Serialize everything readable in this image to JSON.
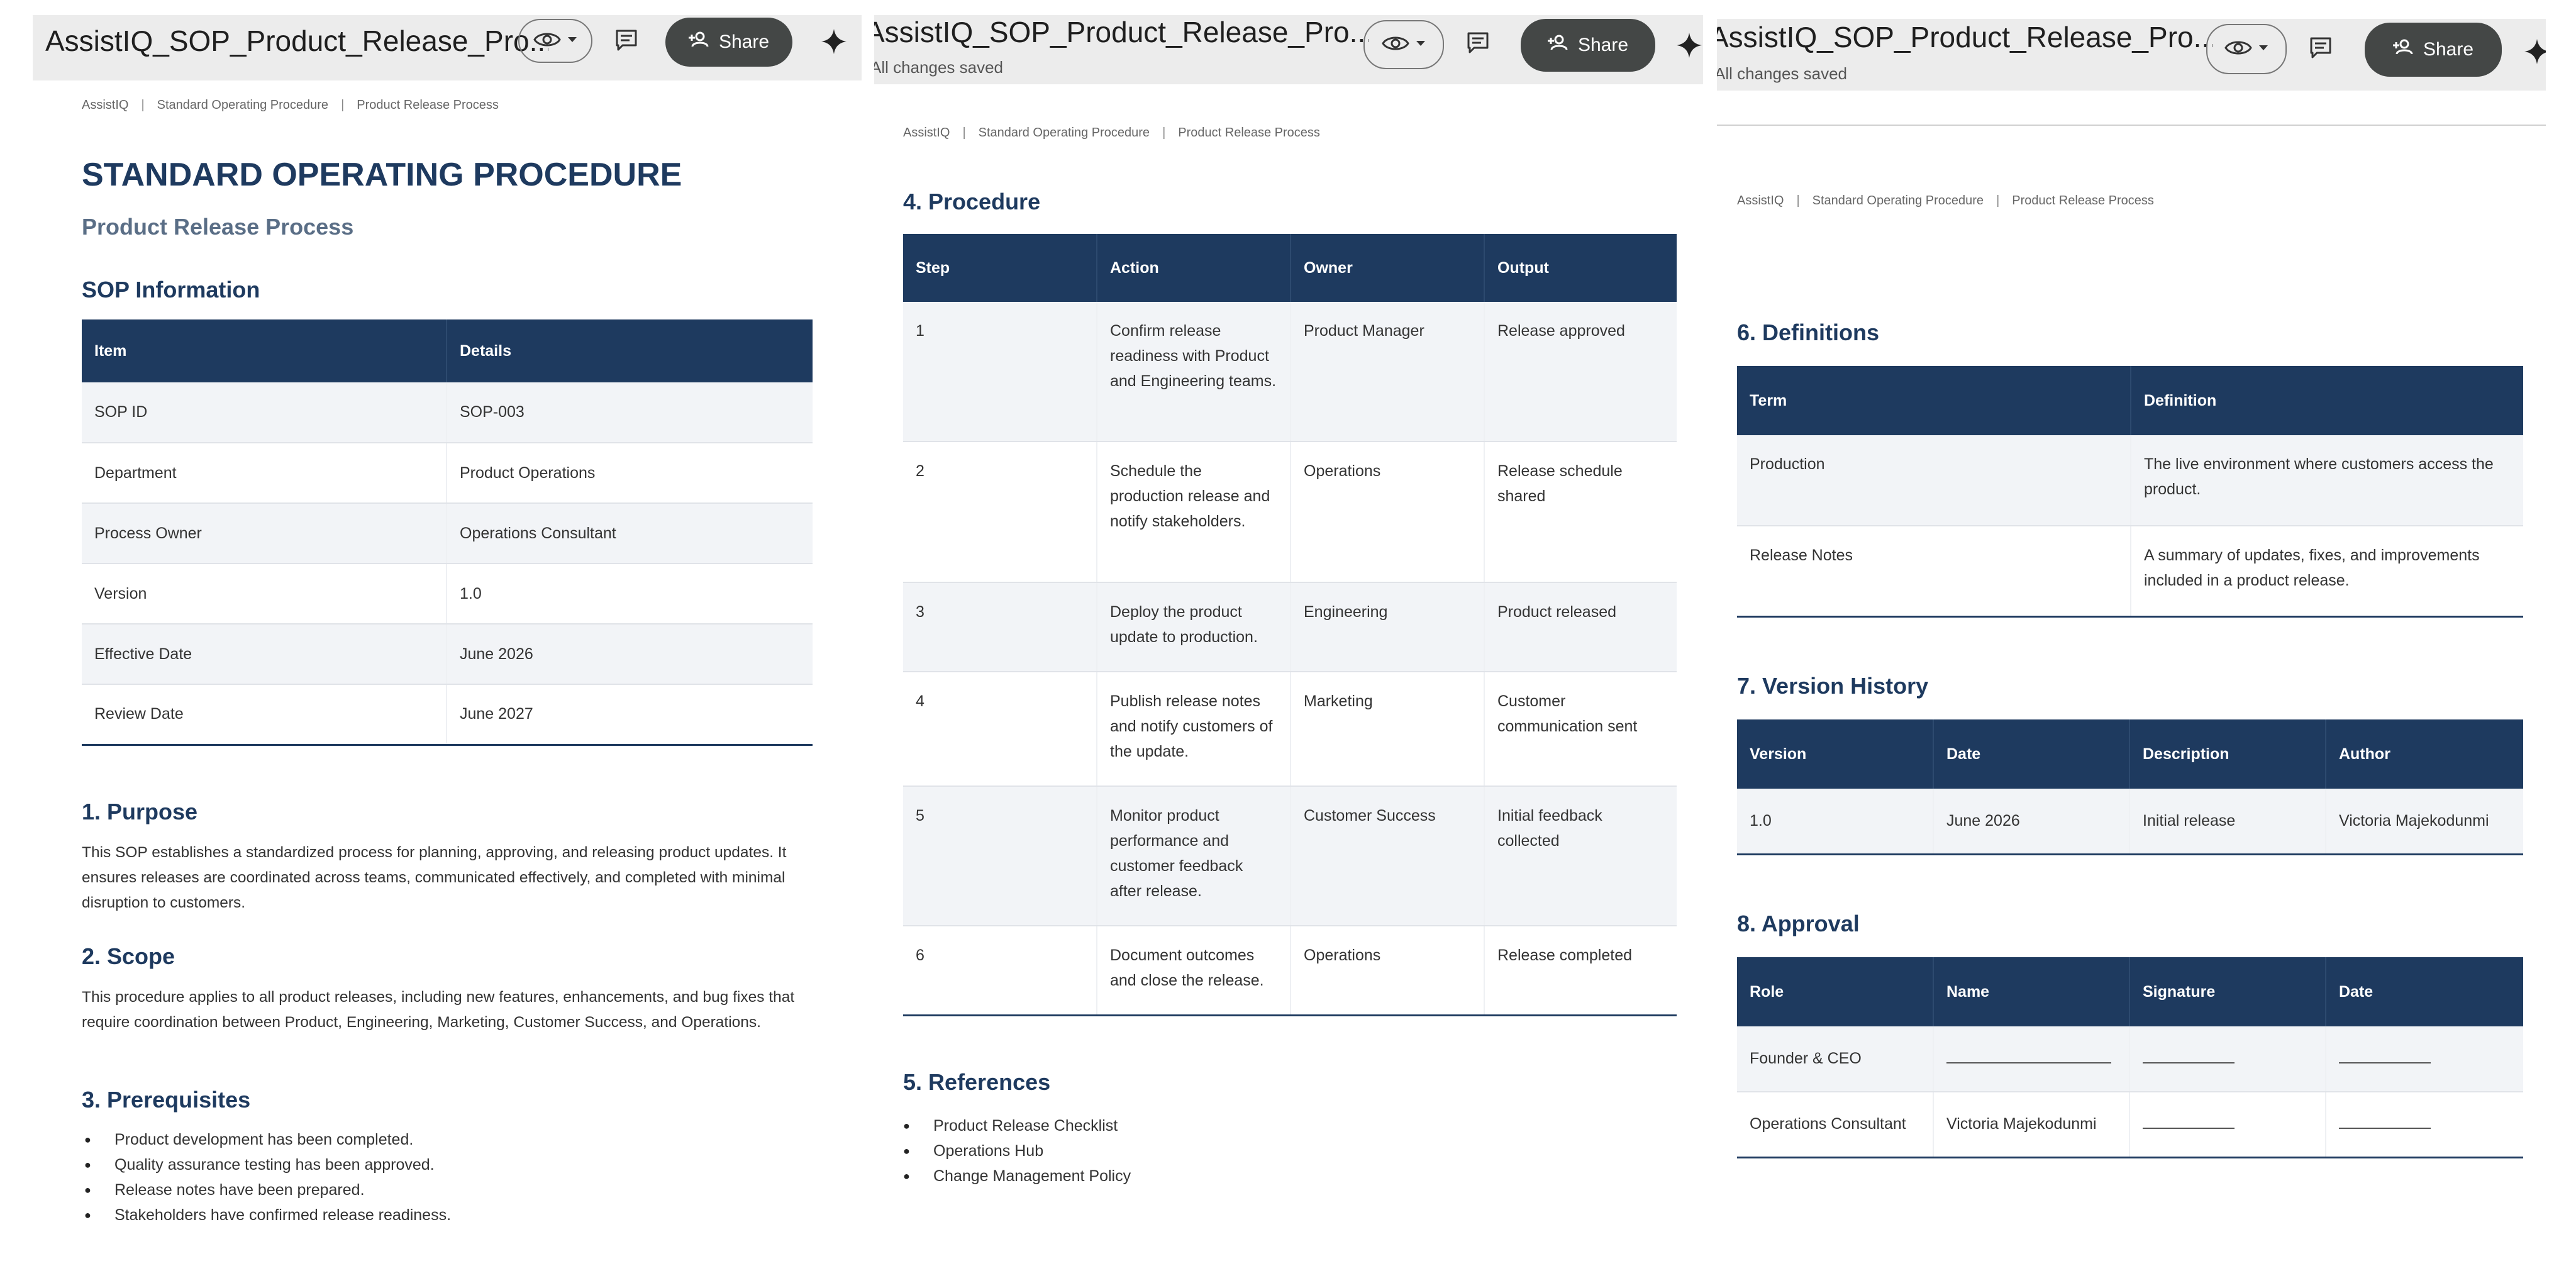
{
  "app": {
    "doc_title_1": "AssistIQ_SOP_Product_Release_Pro...",
    "doc_title_2": "AssistIQ_SOP_Product_Release_Pro...",
    "doc_title_3": "AssistIQ_SOP_Product_Release_Pro...",
    "save_status": "All changes saved",
    "share_label": "Share",
    "icons": [
      "eye-icon",
      "chevron-down-icon",
      "comment-icon",
      "add-person-icon",
      "gemini-sparkle-icon"
    ]
  },
  "breadcrumb": [
    "AssistIQ",
    "Standard Operating Procedure",
    "Product Release Process"
  ],
  "header": {
    "title": "STANDARD OPERATING PROCEDURE",
    "subtitle": "Product Release Process"
  },
  "sop_info": {
    "heading": "SOP Information",
    "columns": [
      "Item",
      "Details"
    ],
    "rows": [
      [
        "SOP ID",
        "SOP-003"
      ],
      [
        "Department",
        "Product Operations"
      ],
      [
        "Process Owner",
        "Operations Consultant"
      ],
      [
        "Version",
        "1.0"
      ],
      [
        "Effective Date",
        "June 2026"
      ],
      [
        "Review Date",
        "June 2027"
      ]
    ]
  },
  "purpose": {
    "heading": "1. Purpose",
    "text": "This SOP establishes a standardized process for planning, approving, and releasing product updates. It ensures releases are coordinated across teams, communicated effectively, and completed with minimal disruption to customers."
  },
  "scope": {
    "heading": "2. Scope",
    "text": "This procedure applies to all product releases, including new features, enhancements, and bug fixes that require coordination between Product, Engineering, Marketing, Customer Success, and Operations."
  },
  "prerequisites": {
    "heading": "3. Prerequisites",
    "items": [
      "Product development has been completed.",
      "Quality assurance testing has been approved.",
      "Release notes have been prepared.",
      "Stakeholders have confirmed release readiness."
    ]
  },
  "procedure": {
    "heading": "4. Procedure",
    "columns": [
      "Step",
      "Action",
      "Owner",
      "Output"
    ],
    "rows": [
      [
        "1",
        "Confirm release readiness with Product and Engineering teams.",
        "Product Manager",
        "Release approved"
      ],
      [
        "2",
        "Schedule the production release and notify stakeholders.",
        "Operations",
        "Release schedule shared"
      ],
      [
        "3",
        "Deploy the product update to production.",
        "Engineering",
        "Product released"
      ],
      [
        "4",
        "Publish release notes and notify customers of the update.",
        "Marketing",
        "Customer communication sent"
      ],
      [
        "5",
        "Monitor product performance and customer feedback after release.",
        "Customer Success",
        "Initial feedback collected"
      ],
      [
        "6",
        "Document outcomes and close the release.",
        "Operations",
        "Release completed"
      ]
    ]
  },
  "references": {
    "heading": "5. References",
    "items": [
      "Product Release Checklist",
      "Operations Hub",
      "Change Management Policy"
    ]
  },
  "definitions": {
    "heading": "6. Definitions",
    "columns": [
      "Term",
      "Definition"
    ],
    "rows": [
      [
        "Production",
        "The live environment where customers access the product."
      ],
      [
        "Release Notes",
        "A summary of updates, fixes, and improvements included in a product release."
      ]
    ]
  },
  "version_history": {
    "heading": "7. Version History",
    "columns": [
      "Version",
      "Date",
      "Description",
      "Author"
    ],
    "rows": [
      [
        "1.0",
        "June 2026",
        "Initial release",
        "Victoria Majekodunmi"
      ]
    ]
  },
  "approval": {
    "heading": "8. Approval",
    "columns": [
      "Role",
      "Name",
      "Signature",
      "Date"
    ],
    "rows": [
      [
        "Founder & CEO",
        "",
        "",
        ""
      ],
      [
        "Operations Consultant",
        "Victoria Majekodunmi",
        "",
        ""
      ]
    ]
  }
}
